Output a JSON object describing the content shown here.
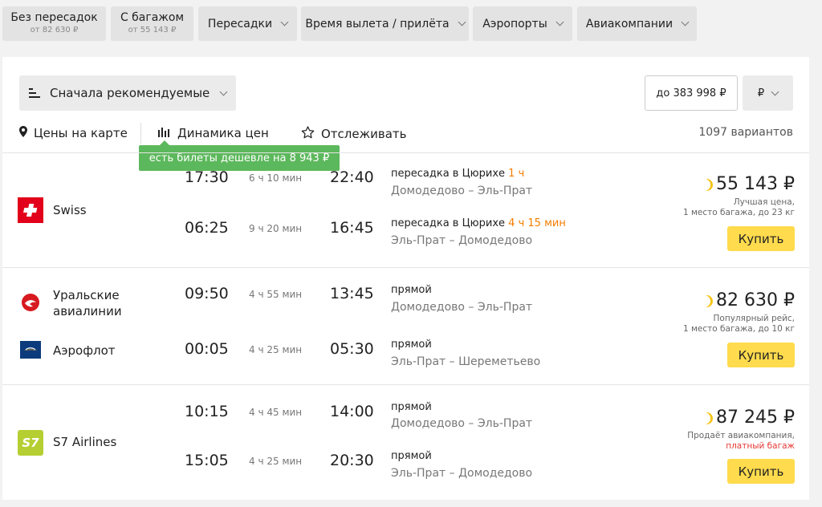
{
  "filters": [
    {
      "label": "Без пересадок",
      "sub": "от 82 630 ₽"
    },
    {
      "label": "С багажом",
      "sub": "от 55 143 ₽"
    },
    {
      "label": "Пересадки"
    },
    {
      "label": "Время вылета / прилёта"
    },
    {
      "label": "Аэропорты"
    },
    {
      "label": "Авиакомпании"
    }
  ],
  "toolbar": {
    "sort_label": "Сначала рекомендуемые",
    "price_filter": "до 383 998 ₽",
    "currency": "₽",
    "map_label": "Цены на карте",
    "dynamics_label": "Динамика цен",
    "track_label": "Отслеживать",
    "variants_count": "1097 вариантов",
    "tooltip": "есть билеты дешевле на 8 943 ₽"
  },
  "colors": {
    "accent_green": "#5cb85c",
    "buy_yellow": "#ffdb4d",
    "orange": "#f57d00",
    "red": "#e53935"
  },
  "results": [
    {
      "airlines": [
        {
          "name": "Swiss",
          "icon": "swiss-cross-logo"
        }
      ],
      "legs": [
        {
          "dep": "17:30",
          "dur": "6 ч 10 мин",
          "arr": "22:40",
          "stop_text": "пересадка в Цюрихе",
          "stop_time": "1 ч",
          "route": "Домодедово – Эль-Прат"
        },
        {
          "dep": "06:25",
          "dur": "9 ч 20 мин",
          "arr": "16:45",
          "stop_text": "пересадка в Цюрихе",
          "stop_time": "4 ч 15 мин",
          "route": "Эль-Прат – Домодедово"
        }
      ],
      "price": "55 143 ₽",
      "note_line1": "Лучшая цена,",
      "note_line2": "1 место багажа, до 23 кг",
      "buy_label": "Купить"
    },
    {
      "airlines": [
        {
          "name_line1": "Уральские",
          "name_line2": "авиалинии",
          "icon": "ural-airlines-logo"
        },
        {
          "name": "Аэрофлот",
          "icon": "aeroflot-logo"
        }
      ],
      "legs": [
        {
          "dep": "09:50",
          "dur": "4 ч 55 мин",
          "arr": "13:45",
          "stop_text": "прямой",
          "route": "Домодедово – Эль-Прат"
        },
        {
          "dep": "00:05",
          "dur": "4 ч 25 мин",
          "arr": "05:30",
          "stop_text": "прямой",
          "route": "Эль-Прат – Шереметьево"
        }
      ],
      "price": "82 630 ₽",
      "note_line1": "Популярный рейс,",
      "note_line2": "1 место багажа, до 10 кг",
      "buy_label": "Купить"
    },
    {
      "airlines": [
        {
          "name": "S7 Airlines",
          "icon": "s7-logo",
          "logo_text": "S7"
        }
      ],
      "legs": [
        {
          "dep": "10:15",
          "dur": "4 ч 45 мин",
          "arr": "14:00",
          "stop_text": "прямой",
          "route": "Домодедово – Эль-Прат"
        },
        {
          "dep": "15:05",
          "dur": "4 ч 25 мин",
          "arr": "20:30",
          "stop_text": "прямой",
          "route": "Эль-Прат – Домодедово"
        }
      ],
      "price": "87 245 ₽",
      "note_line1": "Продаёт авиакомпания,",
      "note_line2": "платный багаж",
      "buy_label": "Купить"
    }
  ]
}
